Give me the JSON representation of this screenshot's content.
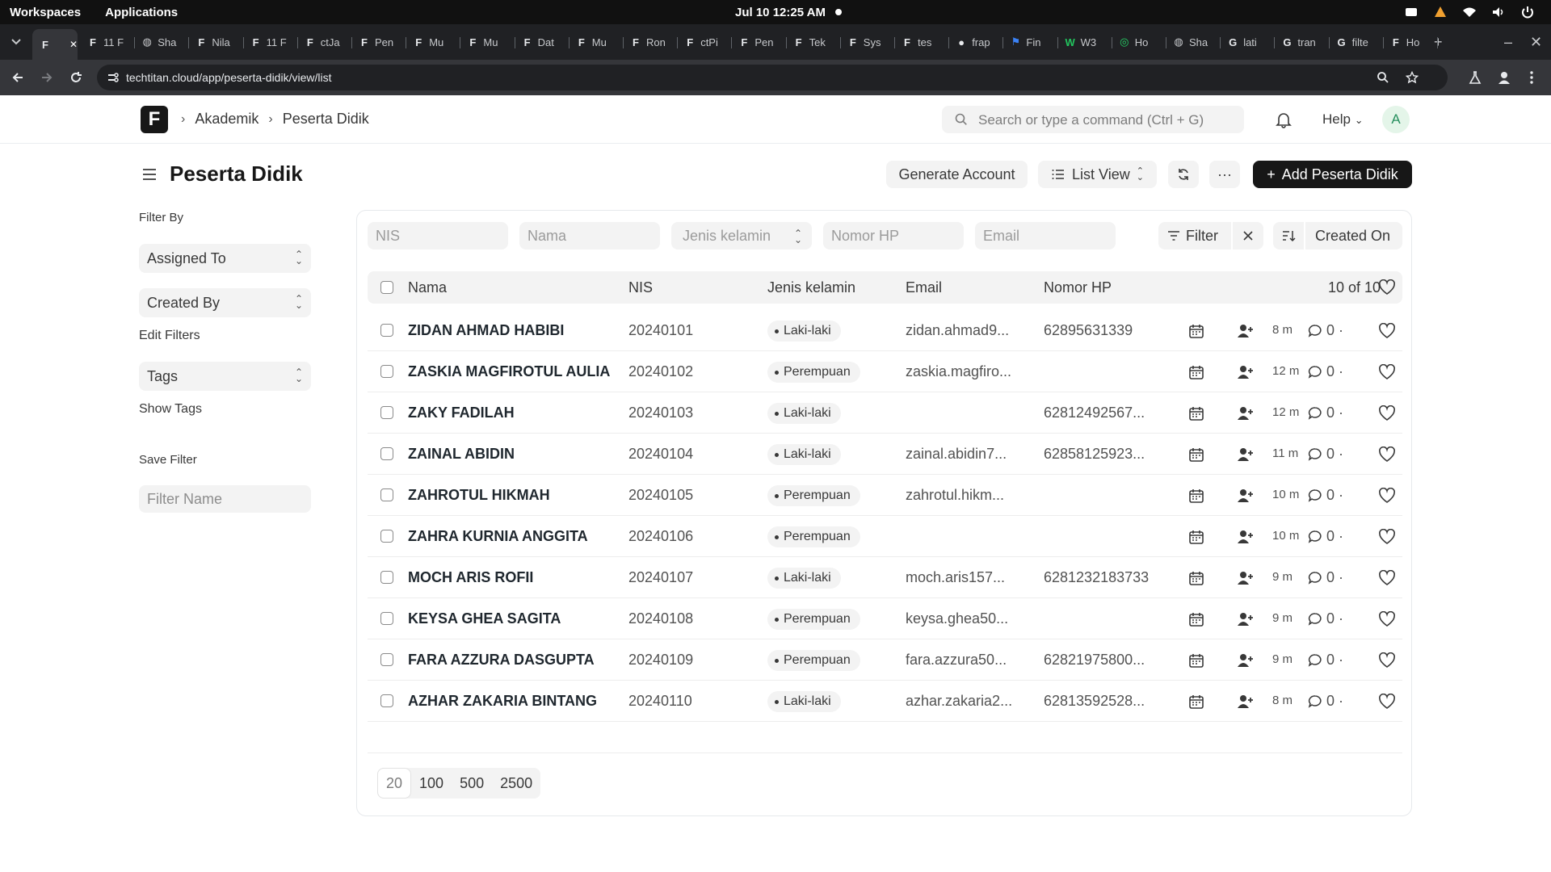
{
  "os": {
    "workspaces": "Workspaces",
    "applications": "Applications",
    "clock": "Jul 10  12:25 AM"
  },
  "tabs": [
    {
      "fav": "F",
      "label": ""
    },
    {
      "fav": "F",
      "label": "11 F"
    },
    {
      "fav": "globe",
      "label": "Sha"
    },
    {
      "fav": "F",
      "label": "Nila"
    },
    {
      "fav": "F",
      "label": "11 F"
    },
    {
      "fav": "F",
      "label": "ctJa"
    },
    {
      "fav": "F",
      "label": "Pen"
    },
    {
      "fav": "F",
      "label": "Mu"
    },
    {
      "fav": "F",
      "label": "Mu"
    },
    {
      "fav": "F",
      "label": "Dat"
    },
    {
      "fav": "F",
      "label": "Mu"
    },
    {
      "fav": "F",
      "label": "Ron"
    },
    {
      "fav": "F",
      "label": "ctPi"
    },
    {
      "fav": "F",
      "label": "Pen"
    },
    {
      "fav": "F",
      "label": "Tek"
    },
    {
      "fav": "F",
      "label": "Sys"
    },
    {
      "fav": "F",
      "label": "tes"
    },
    {
      "fav": "github",
      "label": "frap"
    },
    {
      "fav": "flag",
      "label": "Fin"
    },
    {
      "fav": "w3",
      "label": "W3"
    },
    {
      "fav": "whatsapp",
      "label": "Ho"
    },
    {
      "fav": "globe",
      "label": "Sha"
    },
    {
      "fav": "google",
      "label": "lati"
    },
    {
      "fav": "google",
      "label": "tran"
    },
    {
      "fav": "google",
      "label": "filte"
    },
    {
      "fav": "F",
      "label": "Ho"
    }
  ],
  "browser": {
    "url": "techtitan.cloud/app/peserta-didik/view/list"
  },
  "header": {
    "breadcrumbs": [
      "Akademik",
      "Peserta Didik"
    ],
    "search_placeholder": "Search or type a command (Ctrl + G)",
    "help_label": "Help",
    "avatar_initial": "A"
  },
  "page": {
    "title": "Peserta Didik",
    "generate_account_label": "Generate Account",
    "view_label": "List View",
    "more_label": "···",
    "add_label": "Add Peserta Didik"
  },
  "sidebar": {
    "filter_by": "Filter By",
    "assigned_to": "Assigned To",
    "created_by": "Created By",
    "edit_filters": "Edit Filters",
    "tags": "Tags",
    "show_tags": "Show Tags",
    "save_filter": "Save Filter",
    "filter_name_placeholder": "Filter Name"
  },
  "filters": {
    "nis": "NIS",
    "nama": "Nama",
    "jenis_kelamin": "Jenis kelamin",
    "nomor_hp": "Nomor HP",
    "email": "Email",
    "filter_label": "Filter",
    "sort_label": "Created On"
  },
  "columns": {
    "nama": "Nama",
    "nis": "NIS",
    "jenis_kelamin": "Jenis kelamin",
    "email": "Email",
    "nomor_hp": "Nomor HP",
    "count": "10 of 10"
  },
  "rows": [
    {
      "nama": "ZIDAN AHMAD HABIBI",
      "nis": "20240101",
      "jk": "Laki-laki",
      "email": "zidan.ahmad9...",
      "hp": "62895631339",
      "ago": "8 m",
      "comments": "0"
    },
    {
      "nama": "ZASKIA MAGFIROTUL AULIA",
      "nis": "20240102",
      "jk": "Perempuan",
      "email": "zaskia.magfiro...",
      "hp": "",
      "ago": "12 m",
      "comments": "0"
    },
    {
      "nama": "ZAKY FADILAH",
      "nis": "20240103",
      "jk": "Laki-laki",
      "email": "",
      "hp": "62812492567...",
      "ago": "12 m",
      "comments": "0"
    },
    {
      "nama": "ZAINAL ABIDIN",
      "nis": "20240104",
      "jk": "Laki-laki",
      "email": "zainal.abidin7...",
      "hp": "62858125923...",
      "ago": "11 m",
      "comments": "0"
    },
    {
      "nama": "ZAHROTUL HIKMAH",
      "nis": "20240105",
      "jk": "Perempuan",
      "email": "zahrotul.hikm...",
      "hp": "",
      "ago": "10 m",
      "comments": "0"
    },
    {
      "nama": "ZAHRA KURNIA ANGGITA",
      "nis": "20240106",
      "jk": "Perempuan",
      "email": "",
      "hp": "",
      "ago": "10 m",
      "comments": "0"
    },
    {
      "nama": "MOCH ARIS ROFII",
      "nis": "20240107",
      "jk": "Laki-laki",
      "email": "moch.aris157...",
      "hp": "6281232183733",
      "ago": "9 m",
      "comments": "0"
    },
    {
      "nama": "KEYSA GHEA SAGITA",
      "nis": "20240108",
      "jk": "Perempuan",
      "email": "keysa.ghea50...",
      "hp": "",
      "ago": "9 m",
      "comments": "0"
    },
    {
      "nama": "FARA AZZURA DASGUPTA",
      "nis": "20240109",
      "jk": "Perempuan",
      "email": "fara.azzura50...",
      "hp": "62821975800...",
      "ago": "9 m",
      "comments": "0"
    },
    {
      "nama": "AZHAR ZAKARIA BINTANG",
      "nis": "20240110",
      "jk": "Laki-laki",
      "email": "azhar.zakaria2...",
      "hp": "62813592528...",
      "ago": "8 m",
      "comments": "0"
    }
  ],
  "pager": [
    "20",
    "100",
    "500",
    "2500"
  ],
  "colors": {
    "primary_button": "#171717",
    "avatar_bg": "#e4f5e9",
    "avatar_fg": "#278f5e"
  }
}
